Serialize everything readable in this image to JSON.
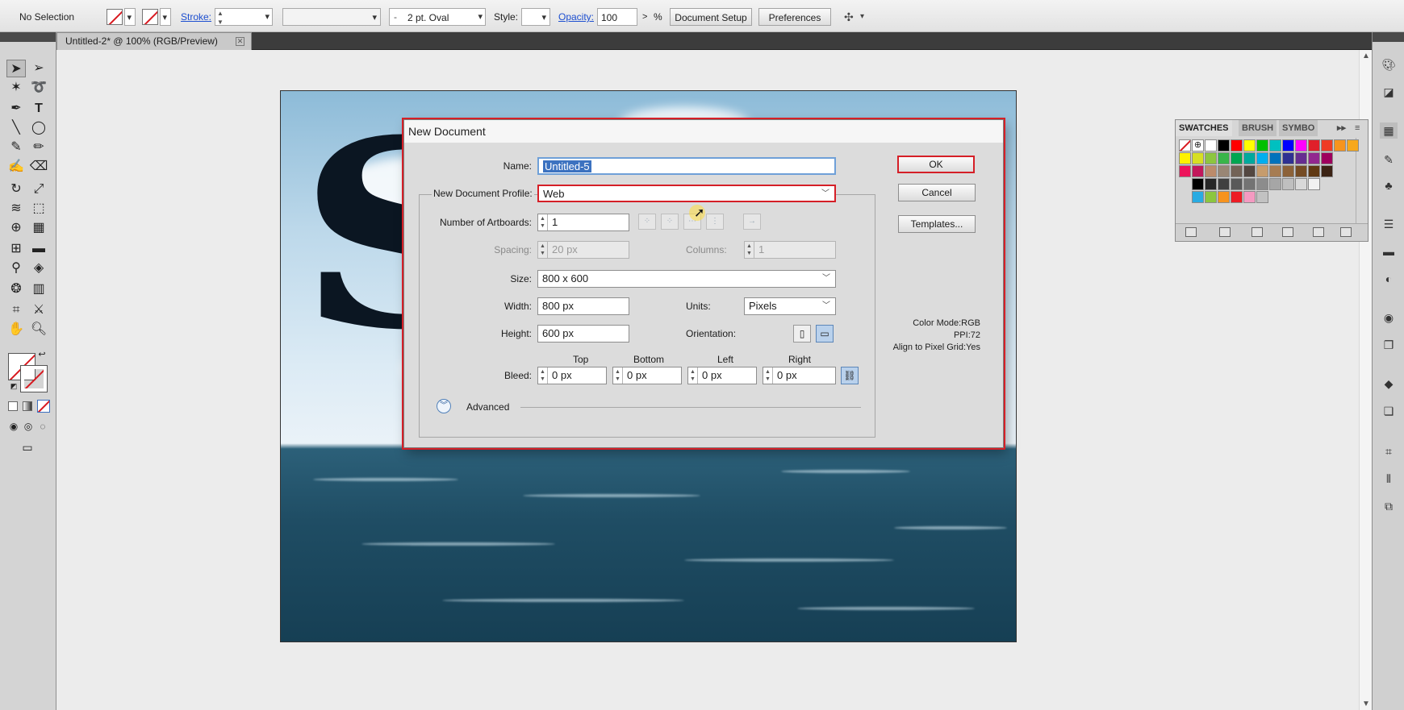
{
  "control_bar": {
    "selection": "No Selection",
    "stroke_label": "Stroke:",
    "brush": "2 pt. Oval",
    "style_label": "Style:",
    "opacity_label": "Opacity:",
    "opacity_value": "100",
    "opacity_unit": "%",
    "document_setup": "Document Setup",
    "preferences": "Preferences"
  },
  "document_tab": {
    "title": "Untitled-2* @ 100% (RGB/Preview)"
  },
  "dialog": {
    "title": "New Document",
    "name_label": "Name:",
    "name_value": "Untitled-5",
    "profile_label": "New Document Profile:",
    "profile_value": "Web",
    "artboards_label": "Number of Artboards:",
    "artboards_value": "1",
    "spacing_label": "Spacing:",
    "spacing_value": "20 px",
    "columns_label": "Columns:",
    "columns_value": "1",
    "size_label": "Size:",
    "size_value": "800 x 600",
    "width_label": "Width:",
    "width_value": "800 px",
    "units_label": "Units:",
    "units_value": "Pixels",
    "height_label": "Height:",
    "height_value": "600 px",
    "orientation_label": "Orientation:",
    "bleed_label": "Bleed:",
    "bleed_headers": [
      "Top",
      "Bottom",
      "Left",
      "Right"
    ],
    "bleed_values": [
      "0 px",
      "0 px",
      "0 px",
      "0 px"
    ],
    "advanced_label": "Advanced",
    "ok": "OK",
    "cancel": "Cancel",
    "templates": "Templates...",
    "info": [
      "Color Mode:RGB",
      "PPI:72",
      "Align to Pixel Grid:Yes"
    ]
  },
  "swatches_panel": {
    "tabs": [
      "SWATCHES",
      "BRUSH",
      "SYMBO"
    ],
    "row_colors": [
      [
        "#ffffff",
        "#000000",
        "#ff0000",
        "#ffff00",
        "#00c000",
        "#00c0c0",
        "#0000ff",
        "#ff00ff",
        "#e0202a",
        "#ef3b24",
        "#f7941d",
        "#f7a81b"
      ],
      [
        "#fff200",
        "#d7df23",
        "#8dc63f",
        "#39b54a",
        "#00a651",
        "#00a99d",
        "#00aeef",
        "#0072bc",
        "#2e3192",
        "#662d91",
        "#92278f",
        "#9e005d"
      ],
      [
        "#ed145b",
        "#c2185b",
        "#bc8b6b",
        "#998675",
        "#736357",
        "#534741",
        "#c69c6d",
        "#a67c52",
        "#8c6239",
        "#754c24",
        "#603913",
        "#3c2415"
      ],
      [
        "#000000",
        "#262626",
        "#404040",
        "#595959",
        "#737373",
        "#8c8c8c",
        "#a6a6a6",
        "#bfbfbf",
        "#d9d9d9",
        "#f2f2f2"
      ],
      [
        "#29abe2",
        "#8cc63f",
        "#f7931e",
        "#ed1c24",
        "#f49ac1",
        "#c2c2c2"
      ]
    ]
  }
}
